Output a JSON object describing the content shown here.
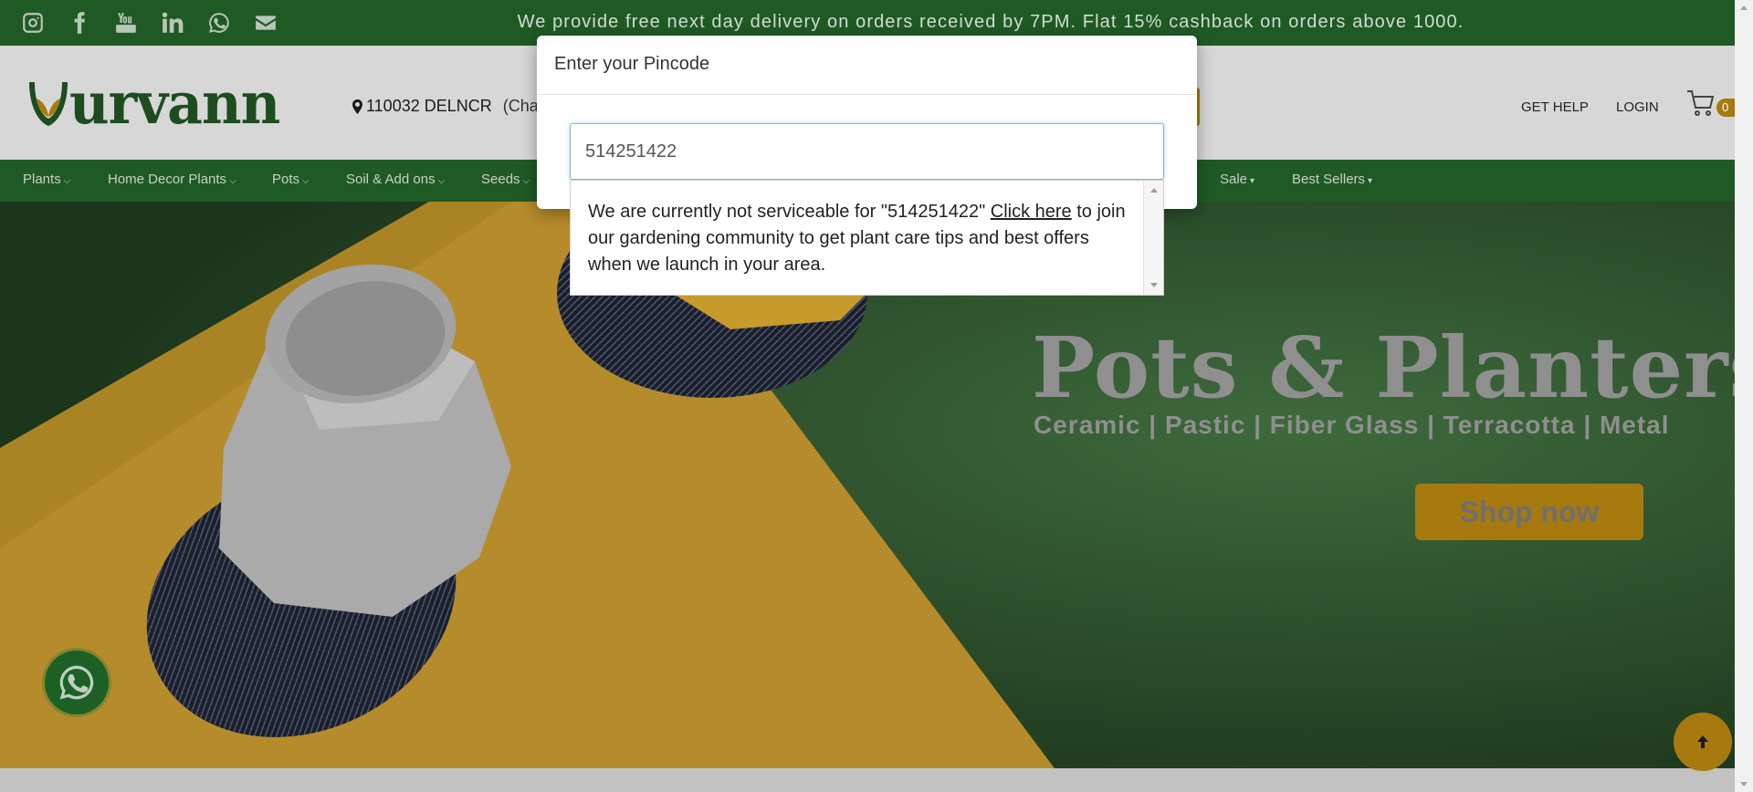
{
  "topbar": {
    "social_icons": [
      "instagram-icon",
      "facebook-icon",
      "youtube-icon",
      "linkedin-icon",
      "whatsapp-icon",
      "email-icon"
    ],
    "promo_text": "We provide free next day delivery on orders received by 7PM. Flat 15% cashback on orders above 1000."
  },
  "header": {
    "logo_text": "urvann",
    "location_pin": "110032 DELNCR",
    "location_extra": "(Chan",
    "get_help": "GET HELP",
    "login": "LOGIN",
    "cart_count": "0"
  },
  "nav": {
    "items": [
      {
        "label": "Plants",
        "chevron": "⌵"
      },
      {
        "label": "Home Decor Plants",
        "chevron": "⌵"
      },
      {
        "label": "Pots",
        "chevron": "⌵"
      },
      {
        "label": "Soil & Add ons",
        "chevron": "⌵"
      },
      {
        "label": "Seeds",
        "chevron": "⌵"
      },
      {
        "label": "Sale",
        "chevron": "▾"
      },
      {
        "label": "Best Sellers",
        "chevron": "▾"
      }
    ]
  },
  "hero": {
    "title": "Pots & Planters",
    "subtitle": "Ceramic | Pastic | Fiber Glass | Terracotta | Metal",
    "cta": "Shop now"
  },
  "modal": {
    "title": "Enter your Pincode",
    "input_value": "514251422",
    "message_before": "We are currently not serviceable for \"514251422\" ",
    "message_link": "Click here",
    "message_after": " to join our gardening community to get plant care tips and best offers when we launch in your area."
  },
  "colors": {
    "brand_green": "#1f5a25",
    "accent_gold": "#a77a10",
    "header_gray": "#d7d7d7"
  }
}
